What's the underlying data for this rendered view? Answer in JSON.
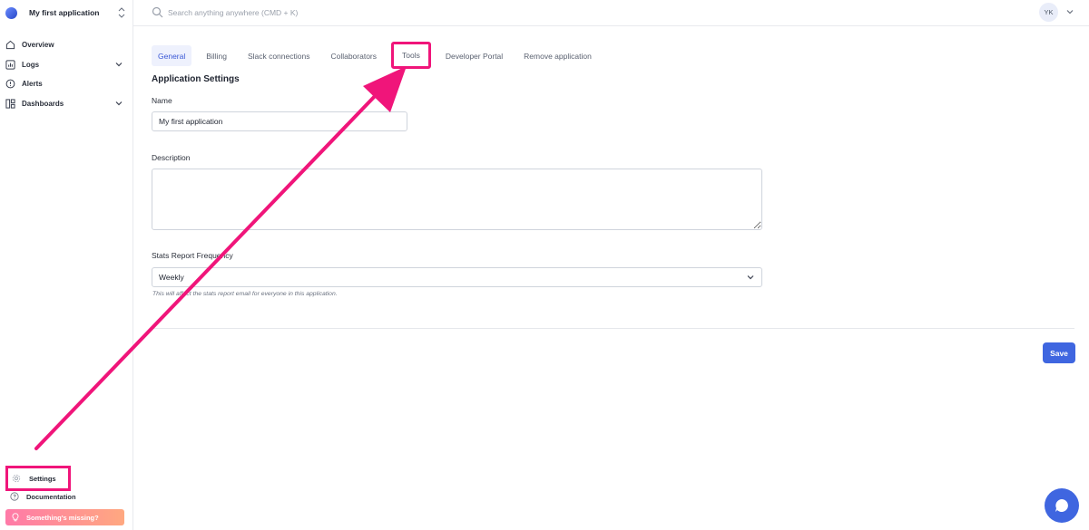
{
  "sidebar": {
    "app_name": "My first application",
    "items": [
      {
        "label": "Overview",
        "icon": "home-icon"
      },
      {
        "label": "Logs",
        "icon": "chart-icon",
        "expandable": true
      },
      {
        "label": "Alerts",
        "icon": "alert-icon"
      },
      {
        "label": "Dashboards",
        "icon": "dashboard-icon",
        "expandable": true
      }
    ],
    "settings_label": "Settings",
    "documentation_label": "Documentation",
    "missing_label": "Something's missing?"
  },
  "topbar": {
    "search_placeholder": "Search anything anywhere (CMD + K)",
    "avatar_initials": "YK"
  },
  "tabs": [
    {
      "label": "General"
    },
    {
      "label": "Billing"
    },
    {
      "label": "Slack connections"
    },
    {
      "label": "Collaborators"
    },
    {
      "label": "Tools"
    },
    {
      "label": "Developer Portal"
    },
    {
      "label": "Remove application"
    }
  ],
  "active_tab": "General",
  "highlighted_tab": "Tools",
  "form": {
    "section_title": "Application Settings",
    "name_label": "Name",
    "name_value": "My first application",
    "description_label": "Description",
    "description_value": "",
    "frequency_label": "Stats Report Frequency",
    "frequency_value": "Weekly",
    "frequency_helper": "This will affect the stats report email for everyone in this application."
  },
  "save_label": "Save",
  "colors": {
    "accent": "#3f66e0",
    "annotation": "#f0157a",
    "active_tab_bg": "#eef1fd"
  }
}
